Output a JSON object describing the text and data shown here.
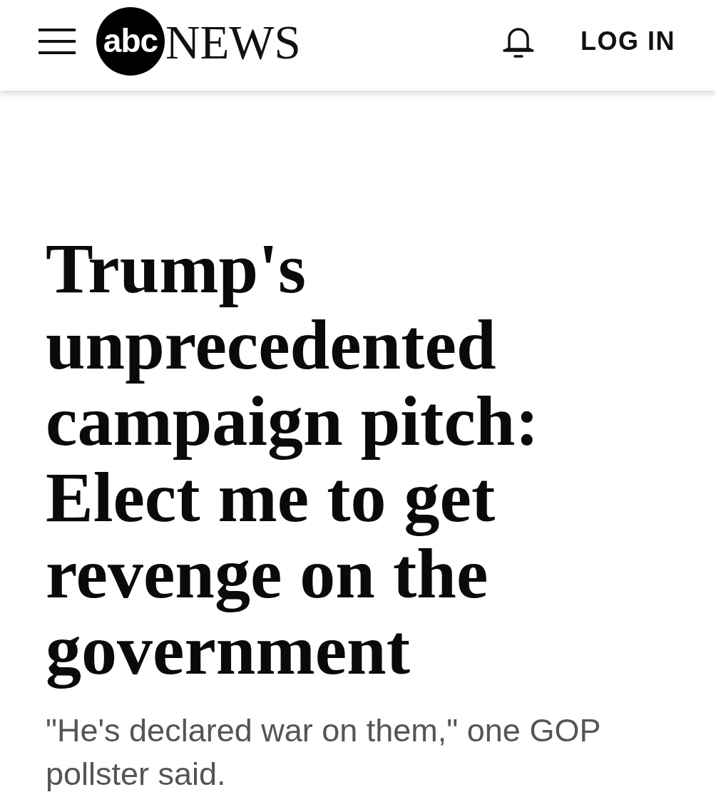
{
  "header": {
    "logo": {
      "badge": "abc",
      "wordmark": "NEWS"
    },
    "login": "LOG IN"
  },
  "article": {
    "headline": "Trump's unprecedented campaign pitch: Elect me to get revenge on the government",
    "subheadline": "\"He's declared war on them,\" one GOP pollster said."
  }
}
